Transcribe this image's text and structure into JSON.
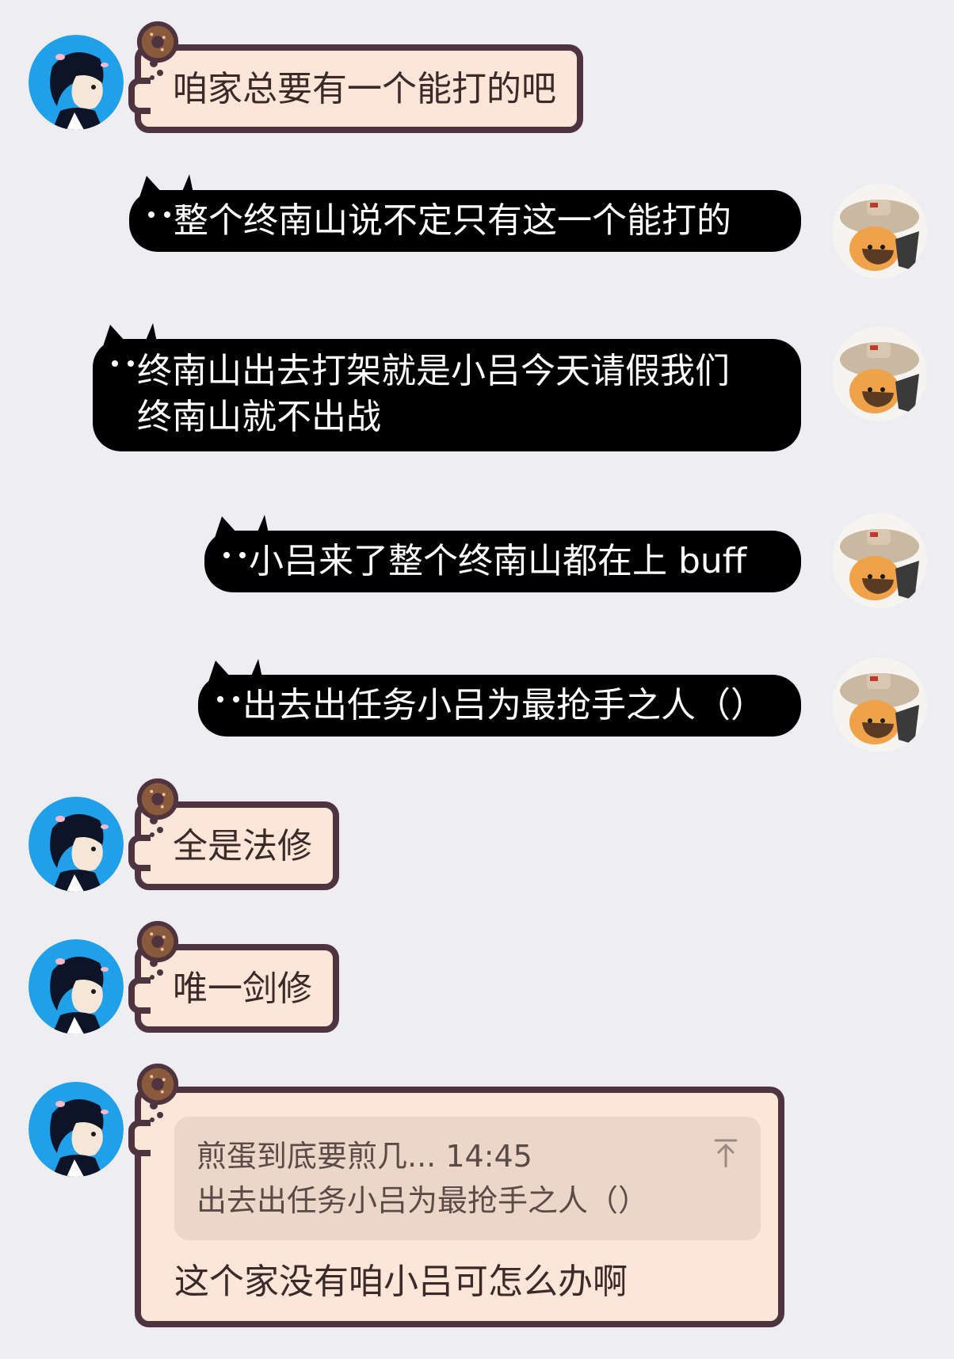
{
  "messages": [
    {
      "side": "left",
      "text": "咱家总要有一个能打的吧"
    },
    {
      "side": "right",
      "text": "整个终南山说不定只有这一个能打的"
    },
    {
      "side": "right",
      "lines": [
        "终南山出去打架就是小吕今天请假我们",
        "终南山就不出战"
      ]
    },
    {
      "side": "right",
      "text": "小吕来了整个终南山都在上 buff"
    },
    {
      "side": "right",
      "text": "出去出任务小吕为最抢手之人（）"
    },
    {
      "side": "left",
      "text": "全是法修"
    },
    {
      "side": "left",
      "text": "唯一剑修"
    },
    {
      "side": "left",
      "quote": {
        "author": "煎蛋到底要煎几...",
        "time": "14:45",
        "text": "出去出任务小吕为最抢手之人（）",
        "icon": "pin-top-icon"
      },
      "text": "这个家没有咱小吕可怎么办啊"
    }
  ],
  "colors": {
    "background": "#ededf2",
    "cream_bubble": "#fde6d8",
    "cream_border": "#4f3440",
    "black_bubble": "#000000",
    "quote_bg": "#ecd6c8"
  },
  "avatars": {
    "left": "anime-boy-avatar",
    "right": "cat-with-hat-avatar"
  }
}
